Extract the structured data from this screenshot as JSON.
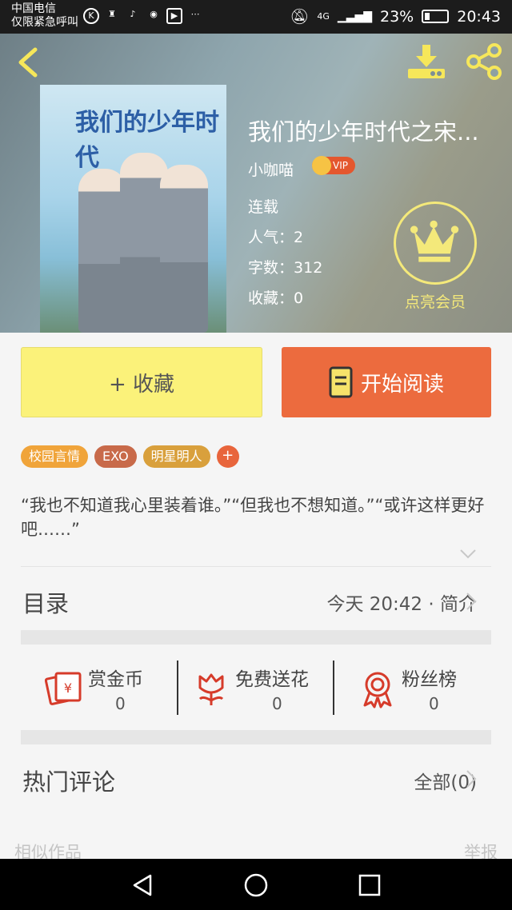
{
  "status_bar": {
    "carrier": "中国电信",
    "emergency": "仅限紧急呼叫",
    "signal": "4G",
    "battery": "23%",
    "time": "20:43"
  },
  "book": {
    "title": "我们的少年时代之宋...",
    "author": "小咖喵",
    "vip_badge": "VIP",
    "status": "连载",
    "popularity_label": "人气：",
    "popularity": "2",
    "words_label": "字数：",
    "words": "312",
    "favorites_label": "收藏：",
    "favorites": "0",
    "cover_title": "我们的少年时代"
  },
  "member": {
    "label": "点亮会员"
  },
  "actions": {
    "favorite": "+ 收藏",
    "read": "开始阅读"
  },
  "tags": [
    {
      "label": "校园言情",
      "color": "#f0a43a"
    },
    {
      "label": "EXO",
      "color": "#c86a4a"
    },
    {
      "label": "明星明人",
      "color": "#d9a03c"
    }
  ],
  "tag_add": "+",
  "synopsis": "“我也不知道我心里装着谁。”“但我也不想知道。”“或许这样更好吧……”",
  "toc": {
    "label": "目录",
    "updated": "今天 20:42 · 简介"
  },
  "stats": [
    {
      "label": "赏金币",
      "value": "0"
    },
    {
      "label": "免费送花",
      "value": "0"
    },
    {
      "label": "粉丝榜",
      "value": "0"
    }
  ],
  "comments": {
    "label": "热门评论",
    "all": "全部(0)"
  },
  "footer": {
    "similar": "相似作品",
    "report": "举报"
  },
  "colors": {
    "accent": "#ec6b3e",
    "yellow": "#fbf27a",
    "icon_red": "#d63b2a"
  }
}
